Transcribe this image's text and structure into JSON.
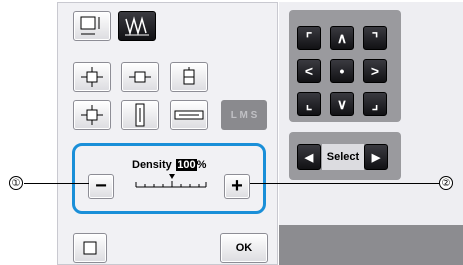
{
  "toolbar": {
    "tab1_icon": "size-adjust-icon",
    "tab2_icon": "density-settings-icon"
  },
  "layout_buttons": [
    {
      "icon": "move-in-icon"
    },
    {
      "icon": "center-vertical-icon"
    },
    {
      "icon": "move-up-icon"
    },
    {
      "icon": "move-out-icon"
    },
    {
      "icon": "stretch-vertical-icon"
    },
    {
      "icon": "stretch-horizontal-icon"
    }
  ],
  "size_label": "L M S",
  "density": {
    "label": "Density",
    "value": "100",
    "unit": "%",
    "minus": "−",
    "plus": "+"
  },
  "arrows": {
    "top_left": "⌜",
    "up": "∧",
    "top_right": "⌝",
    "left": "<",
    "center": "•",
    "right": ">",
    "bottom_left": "⌞",
    "down": "∨",
    "bottom_right": "⌟"
  },
  "select": {
    "label": "Select",
    "prev": "◀",
    "next": "▶"
  },
  "ok_label": "OK",
  "callouts": {
    "one": "①",
    "two": "②"
  },
  "colors": {
    "accent": "#1a8fd8"
  }
}
